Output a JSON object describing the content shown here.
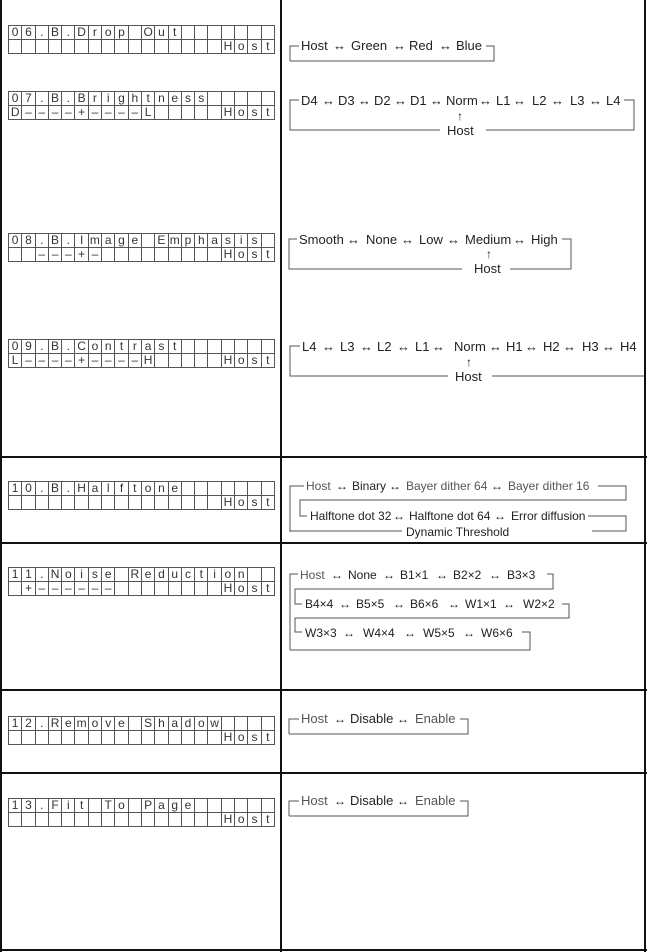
{
  "settings": [
    {
      "id": "06",
      "lcd_line1": [
        "0",
        "6",
        ".",
        "B",
        ".",
        "D",
        "r",
        "o",
        "p",
        " ",
        "O",
        "u",
        "t",
        "",
        "",
        "",
        "",
        "",
        "",
        ""
      ],
      "lcd_line2": [
        "",
        "",
        "",
        "",
        "",
        "",
        "",
        "",
        "",
        "",
        "",
        "",
        "",
        "",
        "",
        "",
        "H",
        "o",
        "s",
        "t"
      ],
      "flow_rows": [
        [
          "Host",
          "Green",
          "Red",
          "Blue"
        ]
      ]
    },
    {
      "id": "07",
      "lcd_line1": [
        "0",
        "7",
        ".",
        "B",
        ".",
        "B",
        "r",
        "i",
        "g",
        "h",
        "t",
        "n",
        "e",
        "s",
        "s",
        "",
        "",
        "",
        "",
        ""
      ],
      "lcd_line2": [
        "D",
        "–",
        "–",
        "–",
        "–",
        "+",
        "–",
        "–",
        "–",
        "–",
        "L",
        "",
        "",
        "",
        "",
        "",
        "H",
        "o",
        "s",
        "t"
      ],
      "flow_rows": [
        [
          "D4",
          "D3",
          "D2",
          "D1",
          "Norm",
          "L1",
          "L2",
          "L3",
          "L4"
        ]
      ],
      "return_label": "Host"
    },
    {
      "id": "08",
      "lcd_line1": [
        "0",
        "8",
        ".",
        "B",
        ".",
        "I",
        "m",
        "a",
        "g",
        "e",
        " ",
        "E",
        "m",
        "p",
        "h",
        "a",
        "s",
        "i",
        "s",
        ""
      ],
      "lcd_line2": [
        "",
        "",
        "–",
        "–",
        "–",
        "+",
        "–",
        "",
        "",
        "",
        "",
        "",
        "",
        "",
        "",
        "",
        "H",
        "o",
        "s",
        "t"
      ],
      "flow_rows": [
        [
          "Smooth",
          "None",
          "Low",
          "Medium",
          "High"
        ]
      ],
      "return_label": "Host"
    },
    {
      "id": "09",
      "lcd_line1": [
        "0",
        "9",
        ".",
        "B",
        ".",
        "C",
        "o",
        "n",
        "t",
        "r",
        "a",
        "s",
        "t",
        "",
        "",
        "",
        "",
        "",
        "",
        ""
      ],
      "lcd_line2": [
        "L",
        "–",
        "–",
        "–",
        "–",
        "+",
        "–",
        "–",
        "–",
        "–",
        "H",
        "",
        "",
        "",
        "",
        "",
        "H",
        "o",
        "s",
        "t"
      ],
      "flow_rows": [
        [
          "L4",
          "L3",
          "L2",
          "L1",
          "Norm",
          "H1",
          "H2",
          "H3",
          "H4"
        ]
      ],
      "return_label": "Host"
    },
    {
      "id": "10",
      "lcd_line1": [
        "1",
        "0",
        ".",
        "B",
        ".",
        "H",
        "a",
        "l",
        "f",
        "t",
        "o",
        "n",
        "e",
        "",
        "",
        "",
        "",
        "",
        "",
        ""
      ],
      "lcd_line2": [
        "",
        "",
        "",
        "",
        "",
        "",
        "",
        "",
        "",
        "",
        "",
        "",
        "",
        "",
        "",
        "",
        "H",
        "o",
        "s",
        "t"
      ],
      "flow_rows": [
        [
          "Host",
          "Binary",
          "Bayer dither 64",
          "Bayer dither 16"
        ],
        [
          "Halftone dot 32",
          "Halftone dot 64",
          "Error diffusion"
        ],
        [
          "Dynamic Threshold"
        ]
      ]
    },
    {
      "id": "11",
      "lcd_line1": [
        "1",
        "1",
        ".",
        "N",
        "o",
        "i",
        "s",
        "e",
        " ",
        "R",
        "e",
        "d",
        "u",
        "c",
        "t",
        "i",
        "o",
        "n",
        "",
        ""
      ],
      "lcd_line2": [
        "",
        "+",
        "–",
        "–",
        "–",
        "–",
        "–",
        "–",
        "",
        "",
        "",
        "",
        "",
        "",
        "",
        "",
        "H",
        "o",
        "s",
        "t"
      ],
      "flow_rows": [
        [
          "Host",
          "None",
          "B1×1",
          "B2×2",
          "B3×3"
        ],
        [
          "B4×4",
          "B5×5",
          "B6×6",
          "W1×1",
          "W2×2"
        ],
        [
          "W3×3",
          "W4×4",
          "W5×5",
          "W6×6"
        ]
      ]
    },
    {
      "id": "12",
      "lcd_line1": [
        "1",
        "2",
        ".",
        "R",
        "e",
        "m",
        "o",
        "v",
        "e",
        " ",
        "S",
        "h",
        "a",
        "d",
        "o",
        "w",
        "",
        "",
        "",
        ""
      ],
      "lcd_line2": [
        "",
        "",
        "",
        "",
        "",
        "",
        "",
        "",
        "",
        "",
        "",
        "",
        "",
        "",
        "",
        "",
        "H",
        "o",
        "s",
        "t"
      ],
      "flow_rows": [
        [
          "Host",
          "Disable",
          "Enable"
        ]
      ]
    },
    {
      "id": "13",
      "lcd_line1": [
        "1",
        "3",
        ".",
        "F",
        "i",
        "t",
        " ",
        "T",
        "o",
        " ",
        "P",
        "a",
        "g",
        "e",
        "",
        "",
        "",
        "",
        "",
        ""
      ],
      "lcd_line2": [
        "",
        "",
        "",
        "",
        "",
        "",
        "",
        "",
        "",
        "",
        "",
        "",
        "",
        "",
        "",
        "",
        "H",
        "o",
        "s",
        "t"
      ],
      "flow_rows": [
        [
          "Host",
          "Disable",
          "Enable"
        ]
      ]
    }
  ],
  "arrow_symbol": "↔",
  "up_arrow_symbol": "↑"
}
